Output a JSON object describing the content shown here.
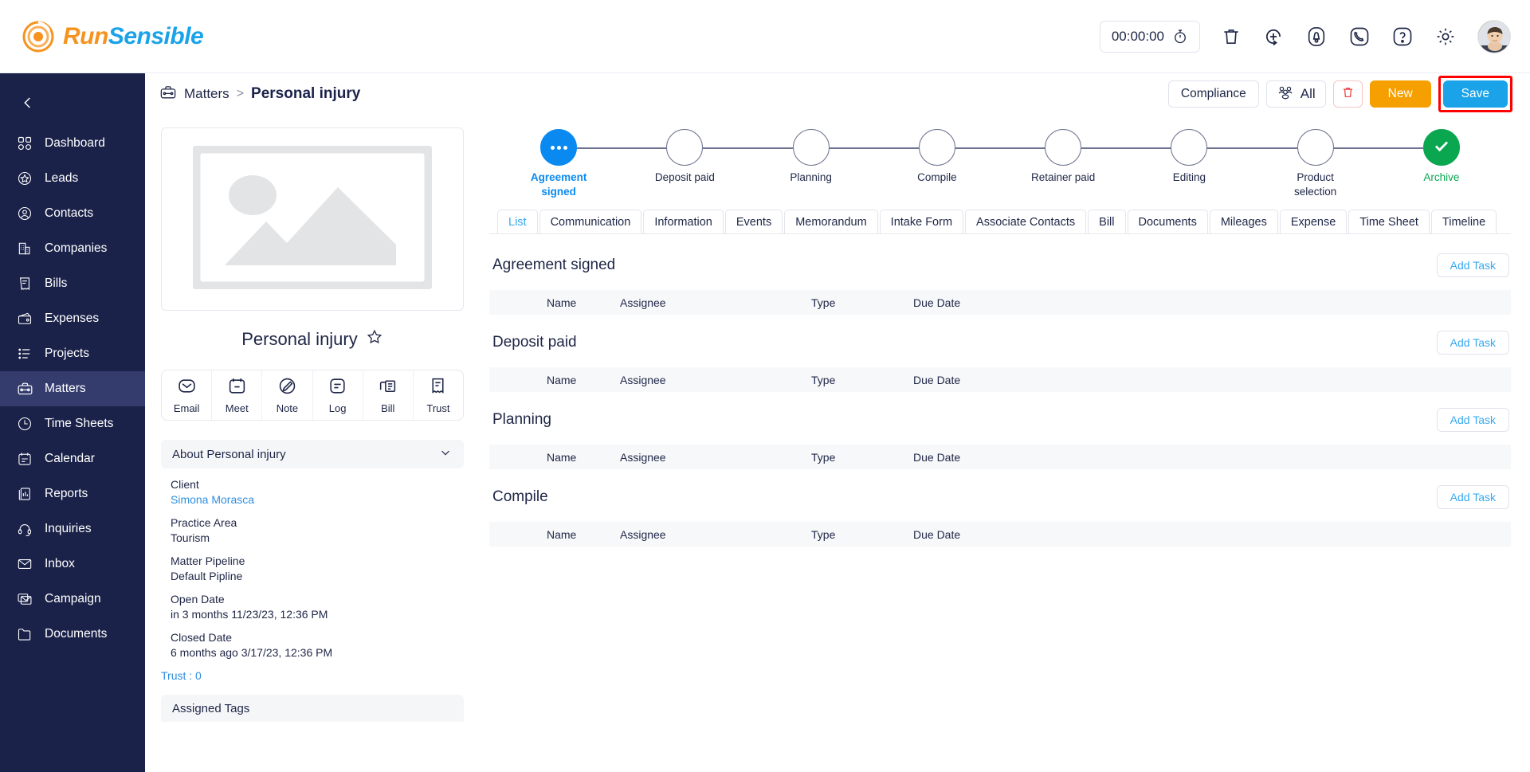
{
  "brand": {
    "run": "Run",
    "sensible": "Sensible",
    "logo_icon": "spiral-logo-icon",
    "orange": "#f6921e",
    "blue": "#1aa3e8"
  },
  "topbar": {
    "timer_value": "00:00:00",
    "timer_icon": "stopwatch-icon",
    "icons": [
      {
        "name": "trash-icon",
        "label": "Delete"
      },
      {
        "name": "add-circle-icon",
        "label": "Quick Add"
      },
      {
        "name": "bell-icon",
        "label": "Notifications"
      },
      {
        "name": "phone-icon",
        "label": "Call"
      },
      {
        "name": "help-icon",
        "label": "Help"
      },
      {
        "name": "gear-icon",
        "label": "Settings"
      }
    ],
    "avatar_alt": "User avatar"
  },
  "sidebar": {
    "collapse_icon": "chevron-left-icon",
    "items": [
      {
        "label": "Dashboard",
        "icon": "dashboard-icon",
        "active": false
      },
      {
        "label": "Leads",
        "icon": "star-circle-icon",
        "active": false
      },
      {
        "label": "Contacts",
        "icon": "person-circle-icon",
        "active": false
      },
      {
        "label": "Companies",
        "icon": "building-icon",
        "active": false
      },
      {
        "label": "Bills",
        "icon": "receipt-icon",
        "active": false
      },
      {
        "label": "Expenses",
        "icon": "wallet-icon",
        "active": false
      },
      {
        "label": "Projects",
        "icon": "list-icon",
        "active": false
      },
      {
        "label": "Matters",
        "icon": "briefcase-icon",
        "active": true
      },
      {
        "label": "Time Sheets",
        "icon": "clock-icon",
        "active": false
      },
      {
        "label": "Calendar",
        "icon": "calendar-icon",
        "active": false
      },
      {
        "label": "Reports",
        "icon": "report-icon",
        "active": false
      },
      {
        "label": "Inquiries",
        "icon": "headset-icon",
        "active": false
      },
      {
        "label": "Inbox",
        "icon": "envelope-icon",
        "active": false
      },
      {
        "label": "Campaign",
        "icon": "campaign-icon",
        "active": false
      },
      {
        "label": "Documents",
        "icon": "folder-icon",
        "active": false
      }
    ]
  },
  "breadcrumb": {
    "icon": "briefcase-icon",
    "root": "Matters",
    "separator": ">",
    "current": "Personal injury"
  },
  "actions": {
    "compliance": "Compliance",
    "all": "All",
    "all_icon": "people-group-icon",
    "trash_icon": "trash-icon",
    "new": "New",
    "save": "Save",
    "save_highlight_color": "#ff0000"
  },
  "left_panel": {
    "photo_placeholder_icon": "image-placeholder-icon",
    "matter_name": "Personal injury",
    "favorite_icon": "star-outline-icon",
    "quick_actions": [
      {
        "label": "Email",
        "icon": "envelope-rounded-icon"
      },
      {
        "label": "Meet",
        "icon": "calendar-icon"
      },
      {
        "label": "Note",
        "icon": "pencil-circle-icon"
      },
      {
        "label": "Log",
        "icon": "log-lines-icon"
      },
      {
        "label": "Bill",
        "icon": "bill-icon"
      },
      {
        "label": "Trust",
        "icon": "receipt-icon"
      }
    ],
    "about_title": "About Personal injury",
    "about_chevron_icon": "chevron-down-icon",
    "fields": [
      {
        "label": "Client",
        "value": "Simona Morasca",
        "link": true
      },
      {
        "label": "Practice Area",
        "value": "Tourism",
        "link": false
      },
      {
        "label": "Matter Pipeline",
        "value": "Default Pipline",
        "link": false
      },
      {
        "label": "Open Date",
        "value": "in 3 months 11/23/23, 12:36 PM",
        "link": false
      },
      {
        "label": "Closed Date",
        "value": "6 months ago 3/17/23, 12:36 PM",
        "link": false
      }
    ],
    "trust_label": "Trust :",
    "trust_value": "0",
    "tags_header": "Assigned Tags"
  },
  "pipeline": {
    "active_color": "#0a8af0",
    "done_color": "#0aa750",
    "steps": [
      {
        "label": "Agreement signed",
        "state": "active",
        "icon": "dots-icon"
      },
      {
        "label": "Deposit paid",
        "state": "pending",
        "icon": ""
      },
      {
        "label": "Planning",
        "state": "pending",
        "icon": ""
      },
      {
        "label": "Compile",
        "state": "pending",
        "icon": ""
      },
      {
        "label": "Retainer paid",
        "state": "pending",
        "icon": ""
      },
      {
        "label": "Editing",
        "state": "pending",
        "icon": ""
      },
      {
        "label": "Product selection",
        "state": "pending",
        "icon": ""
      },
      {
        "label": "Archive",
        "state": "done",
        "icon": "check-icon"
      }
    ]
  },
  "tabs": [
    {
      "label": "List",
      "active": true
    },
    {
      "label": "Communication",
      "active": false
    },
    {
      "label": "Information",
      "active": false
    },
    {
      "label": "Events",
      "active": false
    },
    {
      "label": "Memorandum",
      "active": false
    },
    {
      "label": "Intake Form",
      "active": false
    },
    {
      "label": "Associate Contacts",
      "active": false
    },
    {
      "label": "Bill",
      "active": false
    },
    {
      "label": "Documents",
      "active": false
    },
    {
      "label": "Mileages",
      "active": false
    },
    {
      "label": "Expense",
      "active": false
    },
    {
      "label": "Time Sheet",
      "active": false
    },
    {
      "label": "Timeline",
      "active": false
    }
  ],
  "task_table": {
    "columns": [
      "Name",
      "Assignee",
      "Type",
      "Due Date"
    ],
    "add_task_label": "Add Task"
  },
  "sections": [
    {
      "title": "Agreement signed",
      "rows": []
    },
    {
      "title": "Deposit paid",
      "rows": []
    },
    {
      "title": "Planning",
      "rows": []
    },
    {
      "title": "Compile",
      "rows": []
    }
  ]
}
